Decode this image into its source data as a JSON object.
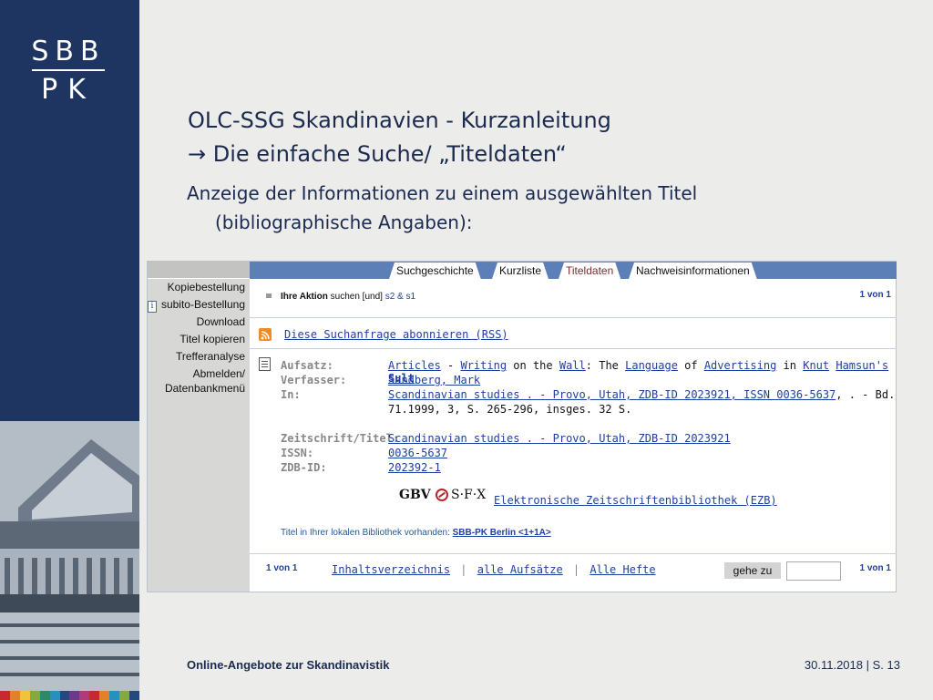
{
  "slide": {
    "title_line1": "OLC-SSG Skandinavien - Kurzanleitung",
    "title_line2": "→ Die einfache Suche/ „Titeldaten“",
    "subtitle_line1": "Anzeige der Informationen zu einem ausgewählten Titel",
    "subtitle_line2": "(bibliographische Angaben):",
    "footer_left": "Online-Angebote zur Skandinavistik",
    "footer_date": "30.11.2018",
    "footer_sep": "|",
    "footer_page": "S. 13"
  },
  "logo": {
    "row1": "SBB",
    "row2": "PK"
  },
  "colors": {
    "band": "#1e3461",
    "strip": [
      "#c6292e",
      "#e1822a",
      "#f0c43a",
      "#86a93b",
      "#2d8a68",
      "#2b8fbd",
      "#23497f",
      "#6a3b8c",
      "#b03b7a",
      "#c6292e",
      "#e1822a",
      "#2b8fbd",
      "#86a93b",
      "#23497f"
    ]
  },
  "sidebar": {
    "items": [
      "Kopiebestellung",
      "subito-Bestellung",
      "Download",
      "Titel kopieren",
      "Trefferanalyse",
      "Abmelden/",
      "Datenbankmenü"
    ],
    "info_icon": "i"
  },
  "tabs": [
    "Suchgeschichte",
    "Kurzliste",
    "Titeldaten",
    "Nachweisinformationen"
  ],
  "action": {
    "label": "Ihre Aktion",
    "text": "suchen [und]",
    "link": "s2 & s1",
    "pager": "1 von 1"
  },
  "rss": {
    "icon": "rss-icon",
    "label": "Diese Suchanfrage abonnieren (RSS)"
  },
  "record": {
    "aufsatz_label": "Aufsatz:",
    "verfasser_label": "Verfasser:",
    "in_label": "In:",
    "title_parts": [
      "Articles",
      " - ",
      "Writing",
      " on the ",
      "Wall",
      ": The ",
      "Language",
      " of ",
      "Advertising",
      " in ",
      "Knut",
      " ",
      "Hamsun's",
      " ",
      "Sult"
    ],
    "verfasser": "Sandberg, Mark",
    "in_link": "Scandinavian studies . - Provo, Utah, ZDB-ID 2023921, ISSN 0036-5637",
    "in_rest": ", . - Bd.",
    "in_line2": "71.1999, 3, S. 265-296, insges. 32 S.",
    "zeitschrift_label": "Zeitschrift/Titel:",
    "zeitschrift": "Scandinavian studies . - Provo, Utah, ZDB-ID 2023921",
    "issn_label": "ISSN:",
    "issn": "0036-5637",
    "zdb_label": "ZDB-ID:",
    "zdb": "202392-1"
  },
  "sfx": {
    "gbv": "GBV",
    "sfx": "S·F·X",
    "link": "Elektronische Zeitschriftenbibliothek (EZB)"
  },
  "local": {
    "text": "Titel in Ihrer lokalen Bibliothek vorhanden:",
    "link": "SBB-PK Berlin <1+1A>"
  },
  "bottom": {
    "pager_left": "1 von 1",
    "links": [
      "Inhaltsverzeichnis",
      "alle Aufsätze",
      "Alle Hefte"
    ],
    "sep": "|",
    "goto_label": "gehe zu",
    "goto_value": "",
    "pager_right": "1 von 1"
  }
}
